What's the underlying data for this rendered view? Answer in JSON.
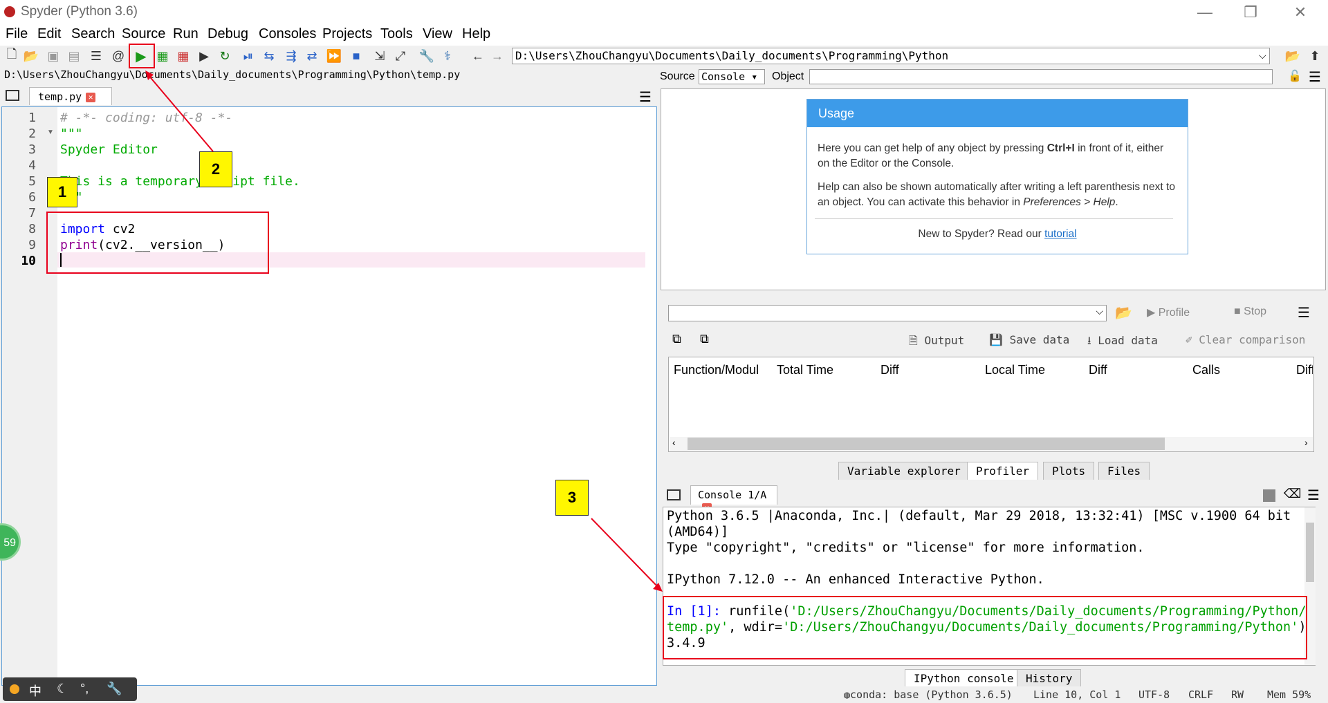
{
  "window": {
    "title": "Spyder (Python 3.6)",
    "min": "—",
    "restore": "❐",
    "close": "✕"
  },
  "menu": [
    "File",
    "Edit",
    "Search",
    "Source",
    "Run",
    "Debug",
    "Consoles",
    "Projects",
    "Tools",
    "View",
    "Help"
  ],
  "toolbar": {
    "path": "D:\\Users\\ZhouChangyu\\Documents\\Daily_documents\\Programming\\Python"
  },
  "editor": {
    "file_path": "D:\\Users\\ZhouChangyu\\Documents\\Daily_documents\\Programming\\Python\\temp.py",
    "tab_label": "temp.py",
    "current_line": 10,
    "lines": [
      {
        "n": "1",
        "text": "# -*- coding: utf-8 -*-"
      },
      {
        "n": "2",
        "text": "\"\"\""
      },
      {
        "n": "3",
        "text": "Spyder Editor"
      },
      {
        "n": "4",
        "text": ""
      },
      {
        "n": "5",
        "text": "This is a temporary script file."
      },
      {
        "n": "6",
        "text": "\"\"\""
      },
      {
        "n": "7",
        "text": ""
      },
      {
        "n": "8",
        "kw": "import",
        "rest": " cv2"
      },
      {
        "n": "9",
        "kw": "print",
        "rest": "(cv2.__version__)"
      },
      {
        "n": "10",
        "text": ""
      }
    ]
  },
  "annotations": {
    "label1": "1",
    "label2": "2",
    "label3": "3"
  },
  "help_pane": {
    "source_label": "Source",
    "source_value": "Console",
    "object_label": "Object",
    "usage_title": "Usage",
    "usage_p1_a": "Here you can get help of any object by pressing ",
    "usage_p1_key": "Ctrl+I",
    "usage_p1_b": " in front of it, either on the Editor or the Console.",
    "usage_p2_a": "Help can also be shown automatically after writing a left parenthesis next to an object. You can activate this behavior in ",
    "usage_p2_em": "Preferences > Help",
    "usage_p2_b": ".",
    "usage_p3_a": "New to Spyder? Read our ",
    "usage_p3_link": "tutorial"
  },
  "profiler": {
    "profile_btn": "Profile",
    "stop_btn": "Stop",
    "output_btn": "Output",
    "save_btn": "Save data",
    "load_btn": "Load data",
    "clear_btn": "Clear comparison",
    "columns": [
      "Function/Modul",
      "Total Time",
      "Diff",
      "Local Time",
      "Diff",
      "Calls",
      "Diff"
    ]
  },
  "mid_tabs": [
    "Variable explorer",
    "Profiler",
    "Plots",
    "Files"
  ],
  "console": {
    "tab_label": "Console 1/A",
    "line1": "Python 3.6.5 |Anaconda, Inc.| (default, Mar 29 2018, 13:32:41) [MSC v.1900 64 bit",
    "line2": "(AMD64)]",
    "line3": "Type \"copyright\", \"credits\" or \"license\" for more information.",
    "line4": "IPython 7.12.0 -- An enhanced Interactive Python.",
    "prompt": "In [1]:",
    "cmd_a": " runfile(",
    "cmd_path1": "'D:/Users/ZhouChangyu/Documents/Daily_documents/Programming/Python/",
    "cmd_path1b": "temp.py'",
    "cmd_mid": ", wdir=",
    "cmd_path2": "'D:/Users/ZhouChangyu/Documents/Daily_documents/Programming/Python'",
    "cmd_end": ")",
    "output": "3.4.9"
  },
  "bottom_tabs": [
    "IPython console",
    "History"
  ],
  "status": {
    "conda": "conda: base (Python 3.6.5)",
    "position": "Line 10, Col 1",
    "encoding": "UTF-8",
    "eol": "CRLF",
    "rw": "RW",
    "mem": "Mem 59%"
  },
  "ime": {
    "lang": "中",
    "float_num": "59"
  }
}
